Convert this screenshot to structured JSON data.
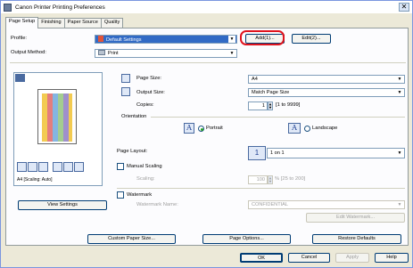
{
  "window": {
    "title": "Canon Printer Printing Preferences",
    "close": "✕"
  },
  "tabs": [
    {
      "label": "Page Setup"
    },
    {
      "label": "Finishing"
    },
    {
      "label": "Paper Source"
    },
    {
      "label": "Quality"
    }
  ],
  "profile": {
    "label": "Profile:",
    "value": "Default Settings",
    "add": "Add(1)...",
    "edit": "Edit(2)..."
  },
  "output_method": {
    "label": "Output Method:",
    "value": "Print"
  },
  "page_size": {
    "label": "Page Size:",
    "value": "A4"
  },
  "output_size": {
    "label": "Output Size:",
    "value": "Match Page Size"
  },
  "copies": {
    "label": "Copies:",
    "value": "1",
    "range": "[1 to 9999]"
  },
  "orientation": {
    "label": "Orientation",
    "portrait": "Portrait",
    "landscape": "Landscape",
    "selected": "Portrait"
  },
  "preview": {
    "caption": "A4 [Scaling: Auto]"
  },
  "page_layout": {
    "label": "Page Layout:",
    "value": "1 on 1"
  },
  "manual_scaling": {
    "label": "Manual Scaling",
    "scaling_label": "Scaling:",
    "value": "100",
    "range": "% [25 to 200]"
  },
  "watermark": {
    "label": "Watermark",
    "name_label": "Watermark Name:",
    "value": "CONFIDENTIAL",
    "edit": "Edit Watermark..."
  },
  "view_settings": "View Settings",
  "bottom_buttons": {
    "custom": "Custom Paper Size...",
    "page_options": "Page Options...",
    "restore": "Restore Defaults"
  },
  "dialog_buttons": {
    "ok": "OK",
    "cancel": "Cancel",
    "apply": "Apply",
    "help": "Help"
  },
  "glyphs": {
    "dropdown": "▼",
    "spin_up": "▲",
    "spin_down": "▼"
  }
}
